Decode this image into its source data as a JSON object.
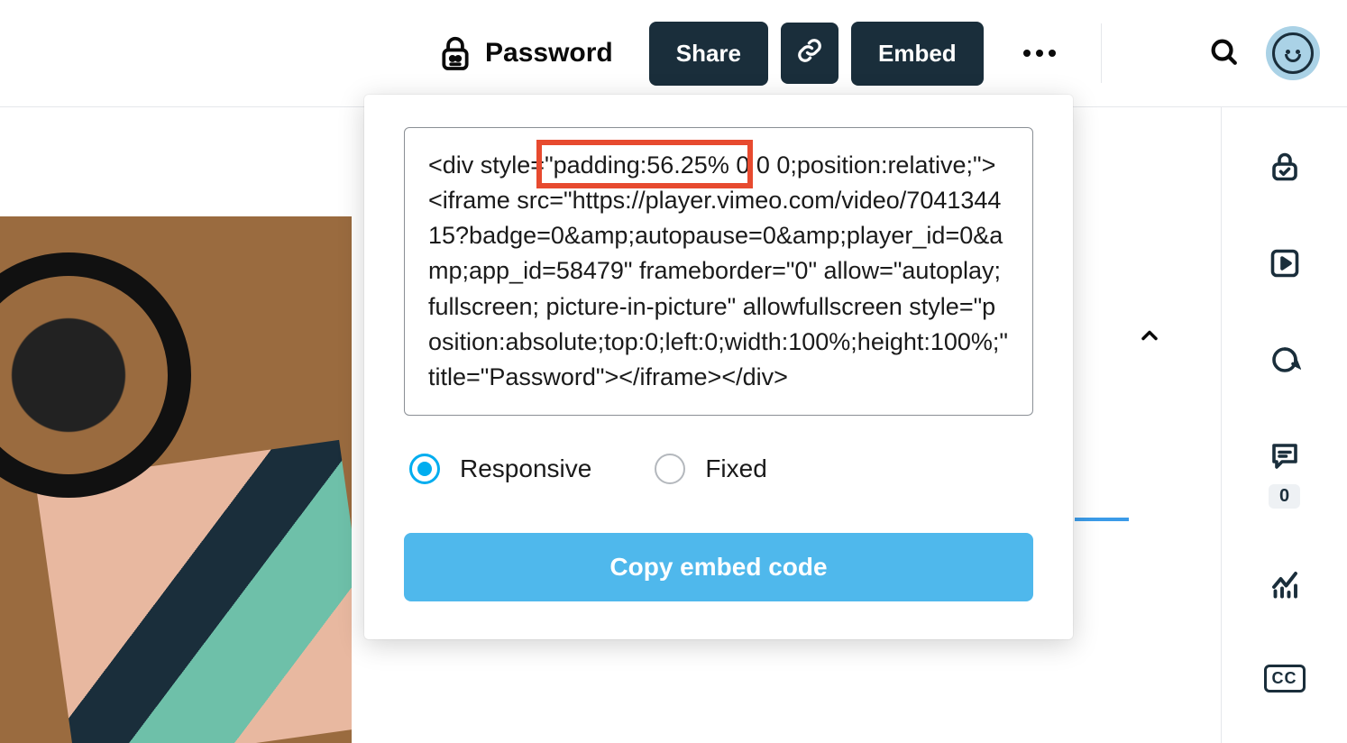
{
  "header": {
    "title": "Password",
    "share_label": "Share",
    "embed_label": "Embed"
  },
  "popover": {
    "embed_code": "<div style=\"padding:56.25% 0 0 0;position:relative;\"><iframe src=\"https://player.vimeo.com/video/704134415?badge=0&amp;autopause=0&amp;player_id=0&amp;app_id=58479\" frameborder=\"0\" allow=\"autoplay; fullscreen; picture-in-picture\" allowfullscreen style=\"position:absolute;top:0;left:0;width:100%;height:100%;\" title=\"Password\"></iframe></div>",
    "highlight_text": "\"padding:56.25%",
    "options": {
      "responsive": "Responsive",
      "fixed": "Fixed",
      "selected": "responsive"
    },
    "copy_button": "Copy embed code"
  },
  "rail": {
    "comments_count": "0",
    "cc_label": "CC"
  }
}
